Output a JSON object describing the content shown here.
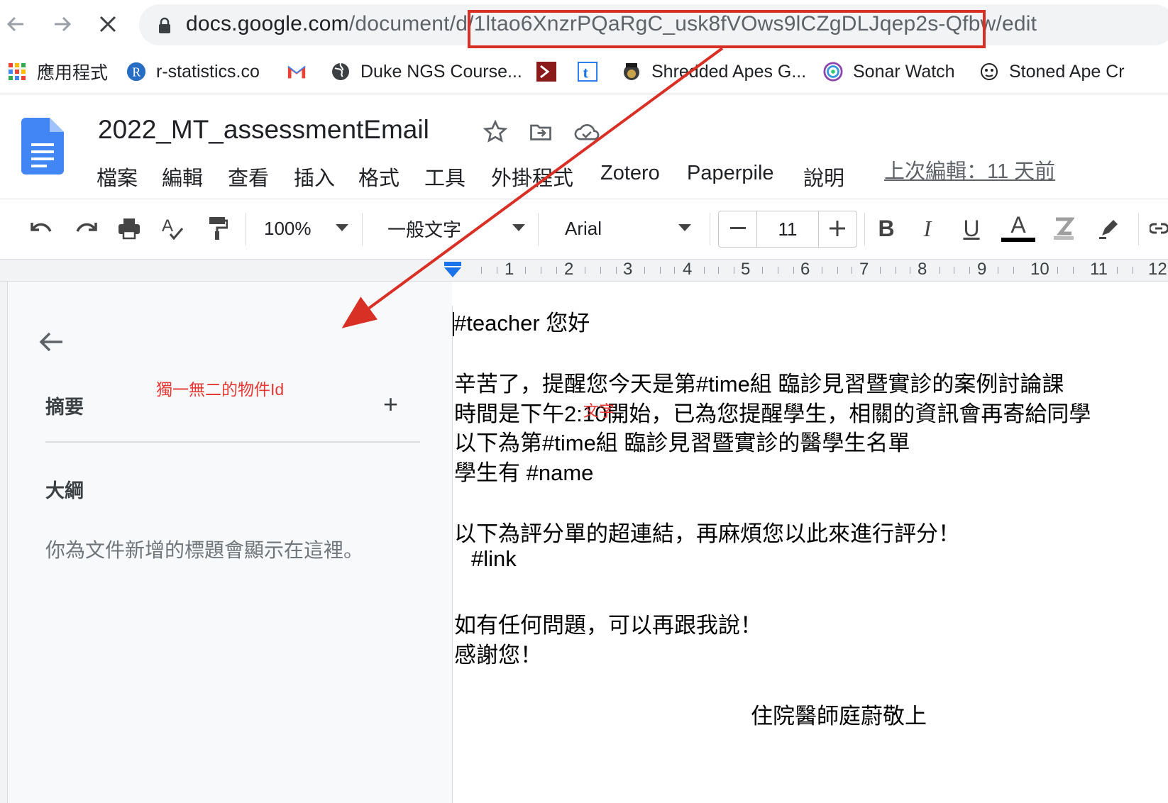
{
  "browser": {
    "url_host": "docs.google.com",
    "url_path_prefix": "/document/d/",
    "url_doc_id": "1ltao6XnzrPQaRgC_usk8fVOws9lCZgDLJqep2s-Qfbw",
    "url_suffix": "/edit",
    "bookmarks": [
      {
        "label": "應用程式",
        "icon": "apps-grid-icon"
      },
      {
        "label": "r-statistics.co",
        "icon": "r-logo-icon"
      },
      {
        "label": "",
        "icon": "gmail-icon"
      },
      {
        "label": "Duke NGS Course...",
        "icon": "globe-icon"
      },
      {
        "label": "",
        "icon": "bookmark-red-icon"
      },
      {
        "label": "",
        "icon": "t-logo-icon"
      },
      {
        "label": "Shredded Apes G...",
        "icon": "ape-icon"
      },
      {
        "label": "Sonar Watch",
        "icon": "sonar-icon"
      },
      {
        "label": "Stoned Ape Cr",
        "icon": "stoned-ape-icon"
      }
    ]
  },
  "docs": {
    "title": "2022_MT_assessmentEmail",
    "menu": [
      "檔案",
      "編輯",
      "查看",
      "插入",
      "格式",
      "工具",
      "外掛程式",
      "Zotero",
      "Paperpile",
      "說明"
    ],
    "last_edit": "上次編輯：11 天前"
  },
  "toolbar": {
    "zoom": "100%",
    "style": "一般文字",
    "font": "Arial",
    "font_size": "11",
    "bold": "B",
    "italic": "I",
    "underline": "U",
    "text_color": "A"
  },
  "ruler": {
    "numbers": [
      "1",
      "2",
      "3",
      "4",
      "5",
      "6",
      "7",
      "8",
      "9",
      "10",
      "11",
      "12"
    ]
  },
  "sidepanel": {
    "summary": "摘要",
    "add": "+",
    "outline": "大綱",
    "outline_empty": "你為文件新增的標題會顯示在這裡。"
  },
  "annotations": {
    "object_id": "獨一無二的物件Id",
    "text": "文字",
    "color": "#e53935"
  },
  "document": {
    "lines": [
      "#teacher 您好",
      "辛苦了，提醒您今天是第#time組 臨診見習暨實診的案例討論課",
      "時間是下午2:10開始，已為您提醒學生，相關的資訊會再寄給同學",
      "以下為第#time組 臨診見習暨實診的醫學生名單",
      "學生有 #name",
      "以下為評分單的超連結，再麻煩您以此來進行評分！",
      "#link",
      "如有任何問題，可以再跟我說！",
      "感謝您！",
      "住院醫師庭蔚敬上"
    ]
  }
}
